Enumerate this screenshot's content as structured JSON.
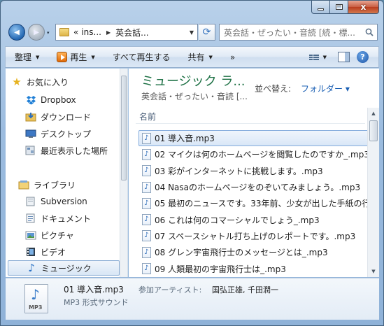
{
  "window": {
    "minimize_glyph": "minimize-icon",
    "maximize_glyph": "maximize-icon",
    "close_glyph": "x"
  },
  "nav": {
    "back_glyph": "◀",
    "forward_glyph": "▶",
    "history_glyph": "▾"
  },
  "address": {
    "overflow": "«",
    "segments": [
      "ins...",
      "英会話..."
    ],
    "refresh_glyph": "⟳"
  },
  "search": {
    "placeholder": "英会話・ぜったい・音読 [続・標..."
  },
  "toolbar": {
    "organize": "整理",
    "play": "再生",
    "play_all": "すべて再生する",
    "share": "共有",
    "more": "»",
    "help": "?"
  },
  "sidebar": {
    "favorites_header": "お気に入り",
    "favorites": [
      "Dropbox",
      "ダウンロード",
      "デスクトップ",
      "最近表示した場所"
    ],
    "libraries_header": "ライブラリ",
    "libraries": [
      "Subversion",
      "ドキュメント",
      "ピクチャ",
      "ビデオ",
      "ミュージック"
    ]
  },
  "library": {
    "title": "ミュージック ラ...",
    "subtitle": "英会話・ぜったい・音読 [...",
    "arrange_label": "並べ替え:",
    "arrange_value": "フォルダー ▾",
    "column_name": "名前"
  },
  "files": [
    "01 導入音.mp3",
    "02 マイクは何のホームページを閲覧したのですか_.mp3",
    "03 彩がインターネットに挑戦します。.mp3",
    "04 Nasaのホームページをのぞいてみましょう。.mp3",
    "05 最初のニュースです。33年前、少女が出した手紙の行",
    "06 これは何のコマーシャルでしょう_.mp3",
    "07 スペースシャトル打ち上げのレポートです。.mp3",
    "08 グレン宇宙飛行士のメッセージとは_.mp3",
    "09 人類最初の宇宙飛行士は_.mp3"
  ],
  "details": {
    "file_name": "01 導入音.mp3",
    "artist_label": "参加アーティスト:",
    "artist_value": "国弘正雄, 千田潤一",
    "file_type": "MP3 形式サウンド",
    "icon_label": "MP3"
  }
}
